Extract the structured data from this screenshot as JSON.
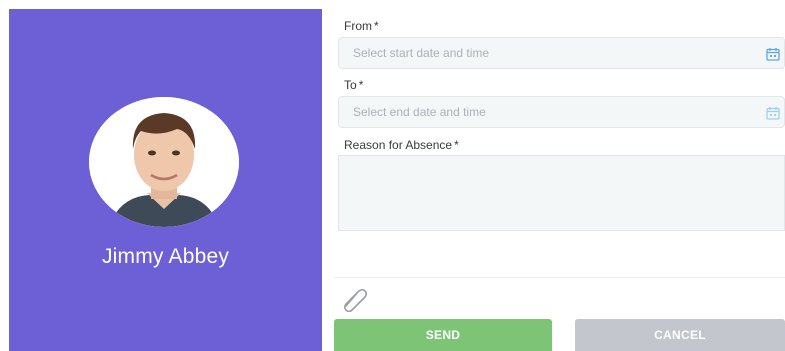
{
  "profile": {
    "name": "Jimmy Abbey",
    "avatar_icon": "user-photo"
  },
  "form": {
    "from": {
      "label": "From",
      "required_mark": "*",
      "placeholder": "Select start date and time",
      "value": "",
      "icon": "calendar-icon"
    },
    "to": {
      "label": "To",
      "required_mark": "*",
      "placeholder": "Select end date and time",
      "value": "",
      "icon": "calendar-icon"
    },
    "reason": {
      "label": "Reason for Absence",
      "required_mark": "*",
      "value": ""
    },
    "attach_icon": "paperclip-icon"
  },
  "buttons": {
    "send_label": "SEND",
    "cancel_label": "CANCEL"
  },
  "colors": {
    "panel": "#6d5fd5",
    "send": "#7dc477",
    "cancel": "#c3c6cc",
    "calendar_icon": "#5aa9e6"
  }
}
